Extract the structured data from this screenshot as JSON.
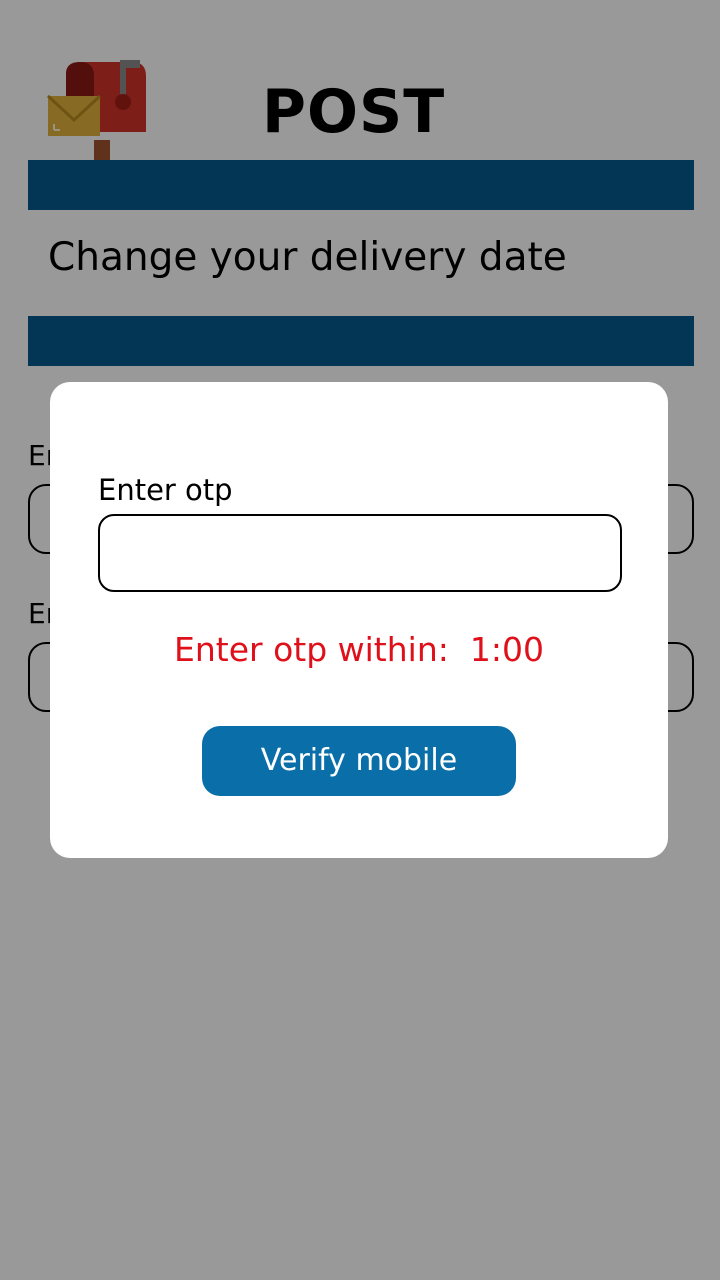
{
  "header": {
    "app_title": "POST",
    "logo_icon": "mailbox-icon",
    "page_heading": "Change your delivery date",
    "band_color": "#045a8d"
  },
  "background_form": {
    "label_1": "En",
    "label_2": "En"
  },
  "otp_modal": {
    "label": "Enter otp",
    "input_value": "",
    "input_placeholder": "",
    "timer_label": "Enter otp within:",
    "timer_value": "1:00",
    "timer_color": "#e0101a",
    "verify_button_label": "Verify mobile",
    "verify_button_color": "#0a6fa8"
  }
}
